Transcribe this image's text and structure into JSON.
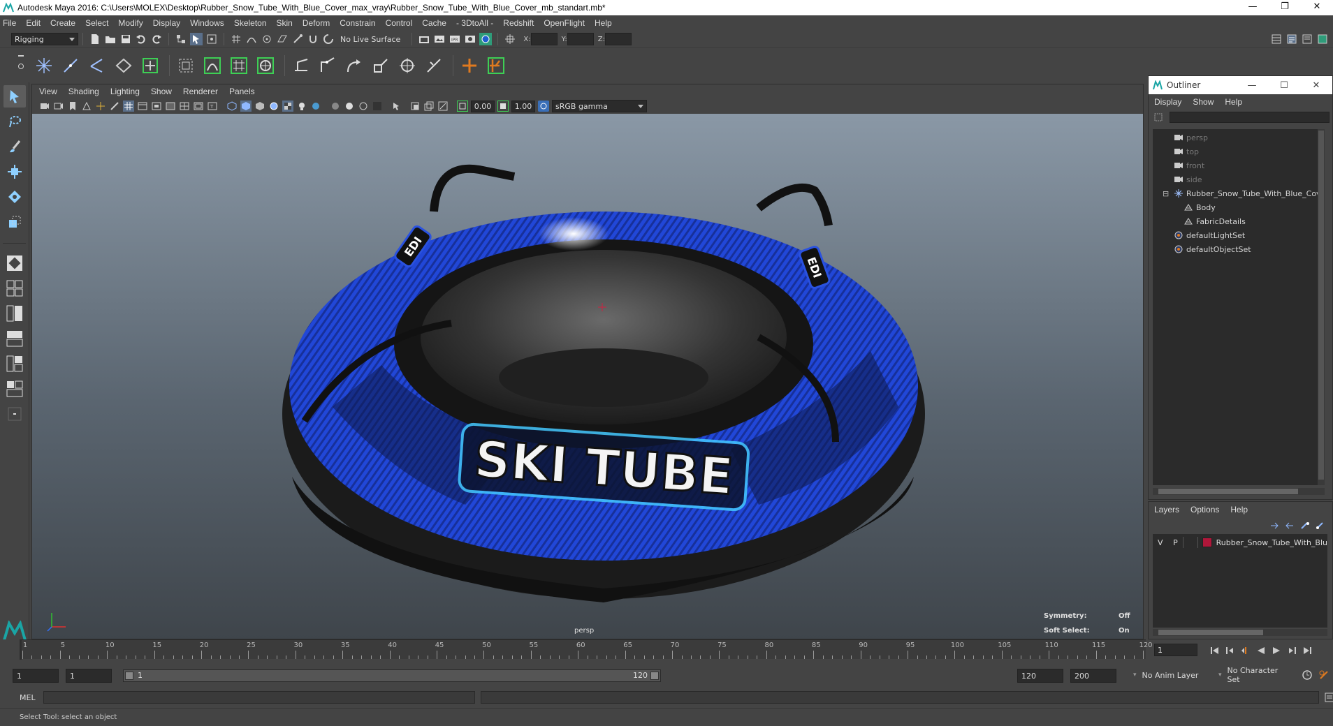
{
  "window": {
    "title": "Autodesk Maya 2016: C:\\Users\\MOLEX\\Desktop\\Rubber_Snow_Tube_With_Blue_Cover_max_vray\\Rubber_Snow_Tube_With_Blue_Cover_mb_standart.mb*",
    "minimize": "—",
    "restore": "❐",
    "close": "✕"
  },
  "menubar": [
    "File",
    "Edit",
    "Create",
    "Select",
    "Modify",
    "Display",
    "Windows",
    "Skeleton",
    "Skin",
    "Deform",
    "Constrain",
    "Control",
    "Cache",
    "- 3DtoAll -",
    "Redshift",
    "OpenFlight",
    "Help"
  ],
  "statusline": {
    "mode": "Rigging",
    "live_surface": "No Live Surface",
    "x_label": "X:",
    "y_label": "Y:",
    "z_label": "Z:"
  },
  "viewport": {
    "menu": [
      "View",
      "Shading",
      "Lighting",
      "Show",
      "Renderer",
      "Panels"
    ],
    "exposure": "0.00",
    "gamma": "1.00",
    "color_space": "sRGB gamma",
    "camera_label": "persp",
    "symmetry_label": "Symmetry:",
    "symmetry_value": "Off",
    "soft_select_label": "Soft Select:",
    "soft_select_value": "On",
    "model_text": "SKI TUBE",
    "badge_text": "EDI"
  },
  "outliner": {
    "title": "Outliner",
    "menu": [
      "Display",
      "Show",
      "Help"
    ],
    "items": [
      {
        "label": "persp",
        "type": "camera",
        "indent": 0,
        "dim": true
      },
      {
        "label": "top",
        "type": "camera",
        "indent": 0,
        "dim": true
      },
      {
        "label": "front",
        "type": "camera",
        "indent": 0,
        "dim": true
      },
      {
        "label": "side",
        "type": "camera",
        "indent": 0,
        "dim": true
      },
      {
        "label": "Rubber_Snow_Tube_With_Blue_Cov",
        "type": "group",
        "indent": 0,
        "dim": false
      },
      {
        "label": "Body",
        "type": "mesh",
        "indent": 1,
        "dim": false
      },
      {
        "label": "FabricDetails",
        "type": "mesh",
        "indent": 1,
        "dim": false
      },
      {
        "label": "defaultLightSet",
        "type": "set",
        "indent": 0,
        "dim": false
      },
      {
        "label": "defaultObjectSet",
        "type": "set",
        "indent": 0,
        "dim": false
      }
    ]
  },
  "layers": {
    "menu": [
      "Layers",
      "Options",
      "Help"
    ],
    "row": {
      "v": "V",
      "p": "P",
      "name": "Rubber_Snow_Tube_With_Blu",
      "color": "#b0173a"
    }
  },
  "timeslider": {
    "ticks": [
      "1",
      "5",
      "10",
      "15",
      "20",
      "25",
      "30",
      "35",
      "40",
      "45",
      "50",
      "55",
      "60",
      "65",
      "70",
      "75",
      "80",
      "85",
      "90",
      "95",
      "100",
      "105",
      "110",
      "115",
      "120"
    ],
    "current_frame": "1"
  },
  "rangeslider": {
    "start": "1",
    "start_inner": "1",
    "range_start": "1",
    "range_end": "120",
    "end": "120",
    "end_outer": "200",
    "anim_layer": "No Anim Layer",
    "character_set": "No Character Set"
  },
  "cmdline": {
    "label": "MEL"
  },
  "helpline": {
    "text": "Select Tool: select an object"
  },
  "colors": {
    "accent_blue": "#2a52e0",
    "shelf_green": "#3ecf55",
    "shelf_orange": "#e07a1f",
    "layer_red": "#b0173a"
  }
}
